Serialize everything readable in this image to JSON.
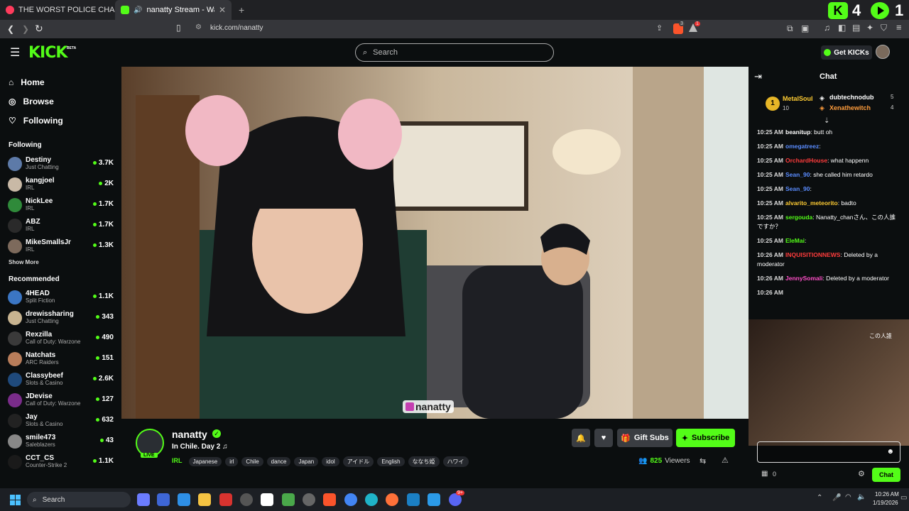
{
  "browser": {
    "tabs": [
      {
        "title": "THE WORST POLICE CHASE I'VE EVER"
      },
      {
        "title": "nanatty Stream - Watch Live o"
      }
    ],
    "url": "kick.com/nanatty",
    "overlay_counts": [
      "4",
      "1"
    ],
    "shield_badge": "3",
    "alert_badge": "1"
  },
  "kick": {
    "logo": "KICK",
    "beta": "BETA",
    "search_placeholder": "Search",
    "get_kicks": "Get KICKs",
    "nav": [
      {
        "label": "Home",
        "icon": "home-icon"
      },
      {
        "label": "Browse",
        "icon": "compass-icon"
      },
      {
        "label": "Following",
        "icon": "heart-icon"
      }
    ],
    "following_title": "Following",
    "following": [
      {
        "name": "Destiny",
        "category": "Just Chatting",
        "viewers": "3.7K",
        "color": "#5d7aa8"
      },
      {
        "name": "kangjoel",
        "category": "IRL",
        "viewers": "2K",
        "color": "#c9b9a6"
      },
      {
        "name": "NickLee",
        "category": "IRL",
        "viewers": "1.7K",
        "color": "#2f8a3a"
      },
      {
        "name": "ABZ",
        "category": "IRL",
        "viewers": "1.7K",
        "color": "#2a2a2a"
      },
      {
        "name": "MikeSmallsJr",
        "category": "IRL",
        "viewers": "1.3K",
        "color": "#7d6a5c"
      }
    ],
    "show_more": "Show More",
    "recommended_title": "Recommended",
    "recommended": [
      {
        "name": "4HEAD",
        "category": "Split Fiction",
        "viewers": "1.1K",
        "color": "#3b76c4"
      },
      {
        "name": "drewissharing",
        "category": "Just Chatting",
        "viewers": "343",
        "color": "#c8b490"
      },
      {
        "name": "Rexzilla",
        "category": "Call of Duty: Warzone",
        "viewers": "490",
        "color": "#3a3a3a"
      },
      {
        "name": "Natchats",
        "category": "ARC Raiders",
        "viewers": "151",
        "color": "#b87d5a"
      },
      {
        "name": "Classybeef",
        "category": "Slots & Casino",
        "viewers": "2.6K",
        "color": "#1f4a7c"
      },
      {
        "name": "JDevise",
        "category": "Call of Duty: Warzone",
        "viewers": "127",
        "color": "#7a2c8a"
      },
      {
        "name": "Jay",
        "category": "Slots & Casino",
        "viewers": "632",
        "color": "#222"
      },
      {
        "name": "smile473",
        "category": "Saleblazers",
        "viewers": "43",
        "color": "#888"
      },
      {
        "name": "CCT_CS",
        "category": "Counter-Strike 2",
        "viewers": "1.1K",
        "color": "#1a1a1a"
      }
    ],
    "stream": {
      "watermark": "nanatty",
      "streamer": "nanatty",
      "live": "LIVE",
      "title": "In Chile. Day 2 ♫",
      "category": "IRL",
      "tags": [
        "Japanese",
        "irl",
        "Chile",
        "dance",
        "Japan",
        "idol",
        "アイドル",
        "English",
        "ななち姫",
        "ハワイ"
      ],
      "viewers": "825",
      "viewers_label": "Viewers",
      "gift_subs": "Gift Subs",
      "subscribe": "Subscribe"
    },
    "chat": {
      "title": "Chat",
      "leaders": [
        {
          "rank": "1",
          "name": "MetalSoul",
          "count": "10",
          "color": "#ffcc33"
        },
        {
          "name": "dubtechnodub",
          "count": "5",
          "color": "#ffffff"
        },
        {
          "name": "Xenathewitch",
          "count": "4",
          "color": "#ff9d3c"
        }
      ],
      "messages": [
        {
          "time": "10:25 AM",
          "user": "beanitup",
          "color": "#ffffff",
          "text": ": butt oh"
        },
        {
          "time": "10:25 AM",
          "user": "omegatreez",
          "color": "#5a8cff",
          "text": ":"
        },
        {
          "time": "10:25 AM",
          "user": "OrchardHouse",
          "color": "#ff3c3c",
          "text": ": what happenn"
        },
        {
          "time": "10:25 AM",
          "user": "Sean_90",
          "color": "#5a8cff",
          "text": ": she called him retardo"
        },
        {
          "time": "10:25 AM",
          "user": "Sean_90",
          "color": "#5a8cff",
          "text": ":"
        },
        {
          "time": "10:25 AM",
          "user": "alvarito_meteorito",
          "color": "#ffcc33",
          "text": ": badto"
        },
        {
          "time": "10:25 AM",
          "user": "sergouda",
          "color": "#53fc18",
          "text": ": Nanatty_chanさん、この人誰ですか？"
        },
        {
          "time": "10:25 AM",
          "user": "EleMai",
          "color": "#53fc18",
          "text": ":"
        },
        {
          "time": "10:26 AM",
          "user": "INQUISITIONNEWS",
          "color": "#ff3c3c",
          "text": ": Deleted by a moderator"
        },
        {
          "time": "10:26 AM",
          "user": "JennySomali",
          "color": "#ff4fc8",
          "text": ": Deleted by a moderator"
        },
        {
          "time": "10:26 AM",
          "user": "",
          "color": "#ff3c3c",
          "text": ""
        }
      ],
      "overlay_text": "この人誰",
      "points": "0",
      "send": "Chat"
    }
  },
  "taskbar": {
    "search": "Search",
    "time": "10:26 AM",
    "date": "1/19/2026",
    "discord_badge": "9+"
  }
}
